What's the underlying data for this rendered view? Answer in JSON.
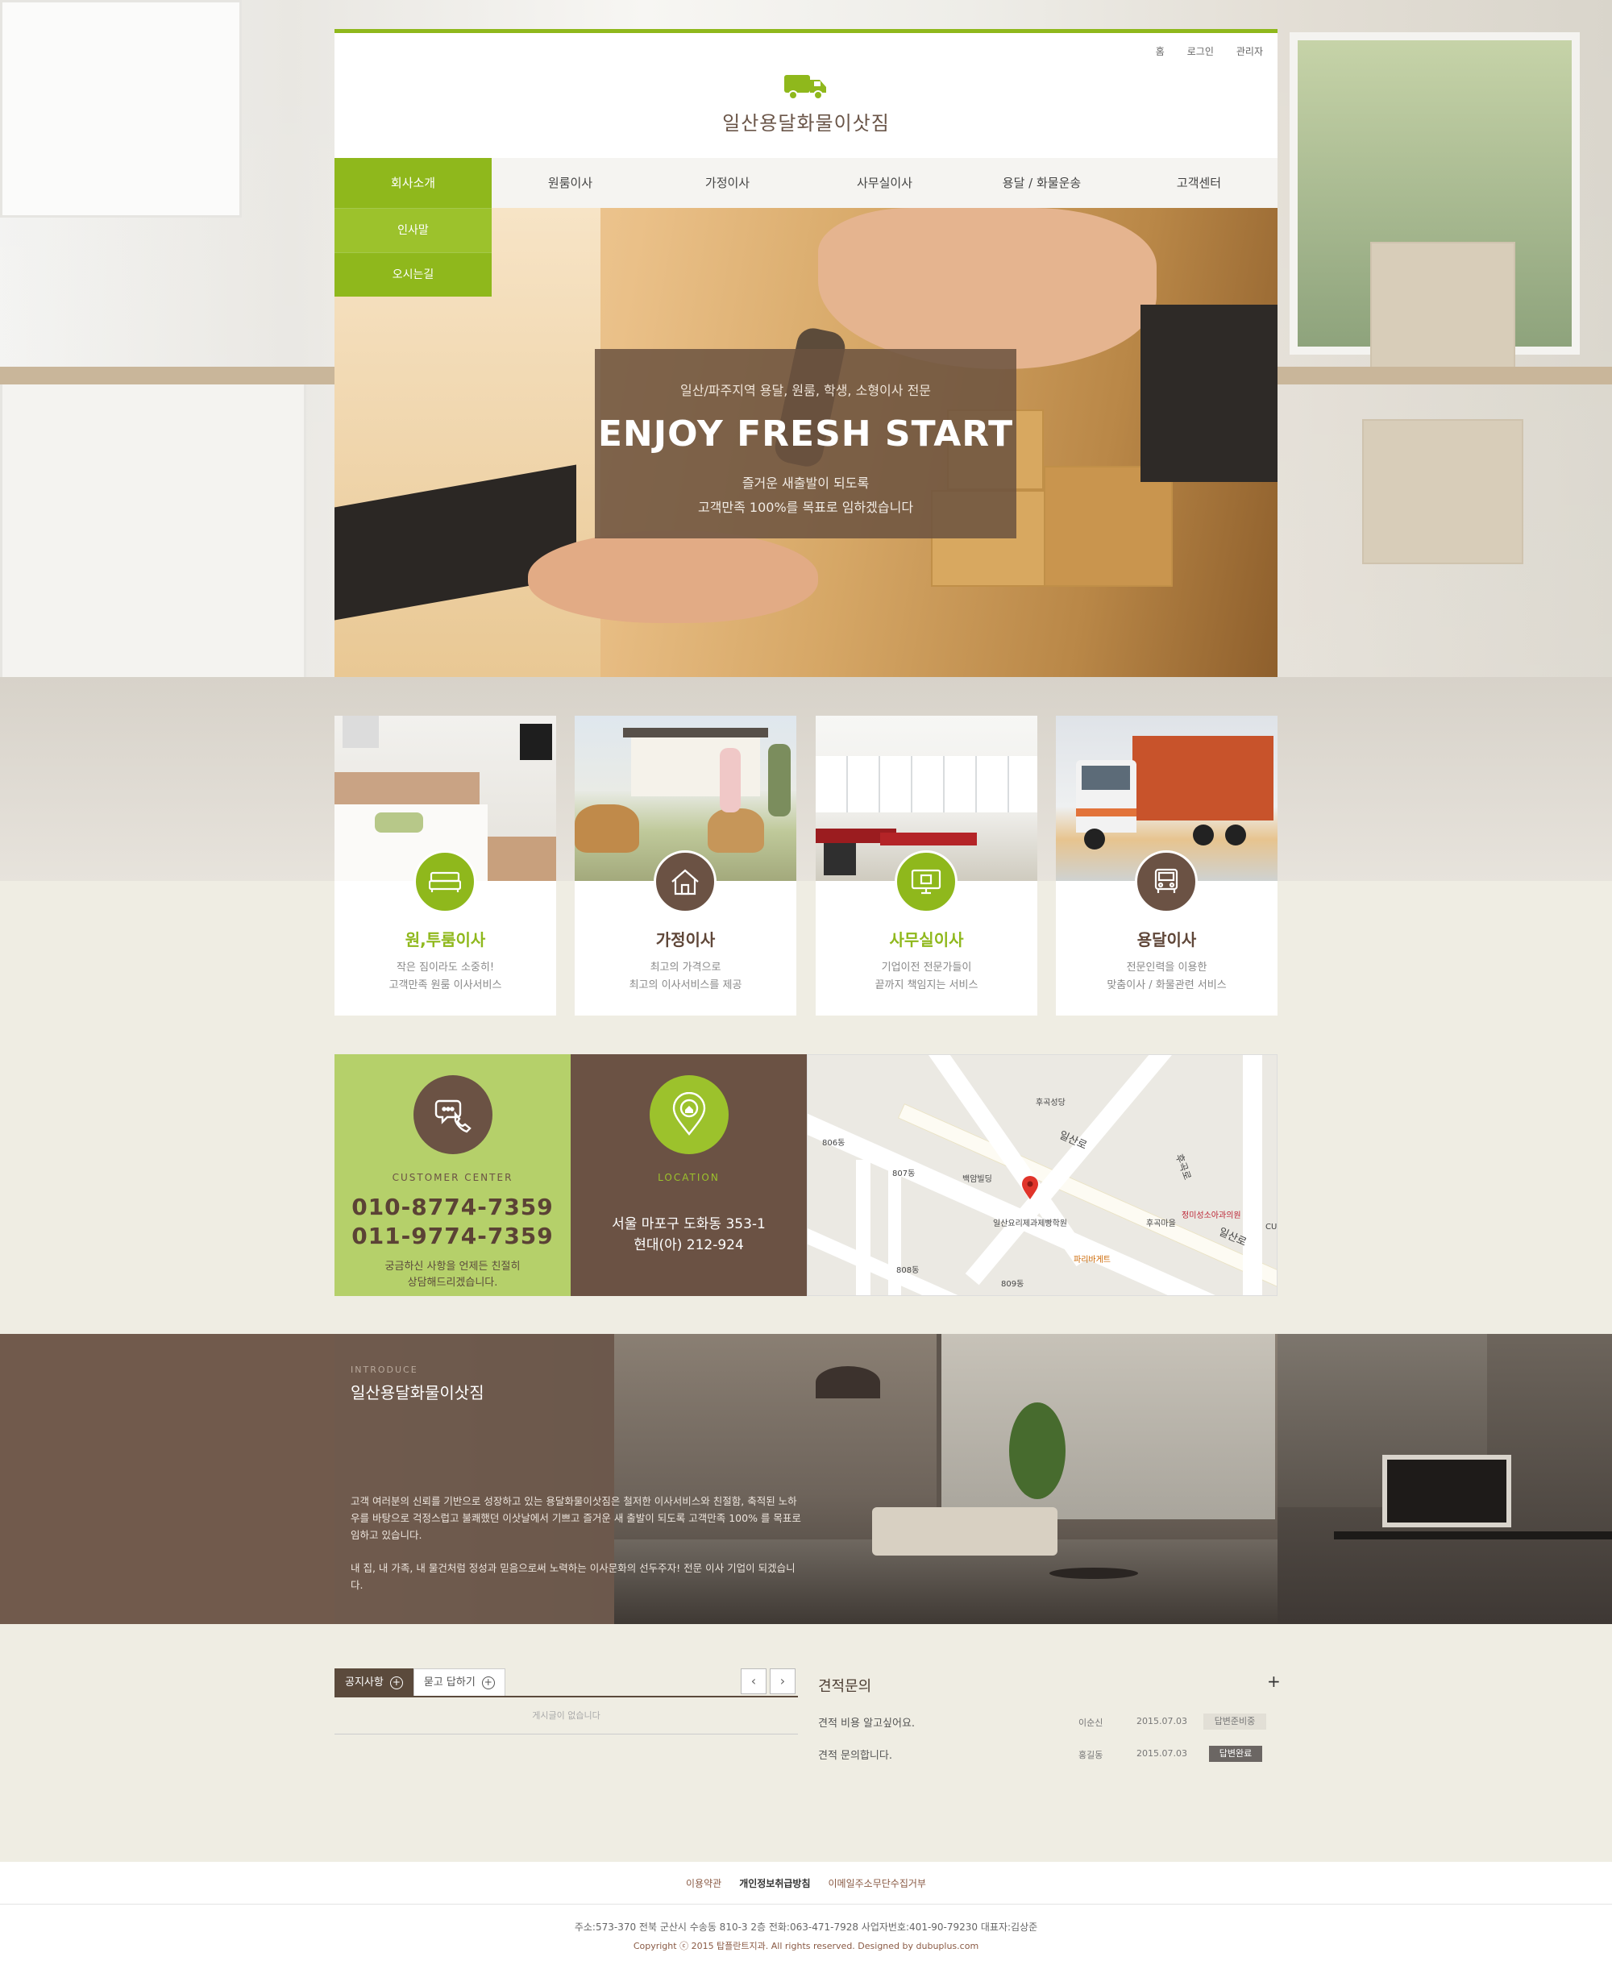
{
  "brand": {
    "name": "일산용달화물이삿짐",
    "accent": "#8fb81c",
    "brown": "#6b5244",
    "truck_icon": "truck-icon"
  },
  "util_links": [
    "홈",
    "로그인",
    "관리자"
  ],
  "nav": [
    "회사소개",
    "원룸이사",
    "가정이사",
    "사무실이사",
    "용달 / 화물운송",
    "고객센터"
  ],
  "submenu": [
    "인사말",
    "오시는길"
  ],
  "hero": {
    "subtitle": "일산/파주지역 용달, 원룸, 학생, 소형이사 전문",
    "title": "ENJOY FRESH START",
    "line1": "즐거운 새출발이 되도록",
    "line2": "고객만족 100%를 목표로 임하겠습니다"
  },
  "services": [
    {
      "title": "원,투룸이사",
      "desc1": "작은 짐이라도 소중히!",
      "desc2": "고객만족 원룸 이사서비스",
      "icon": "bed-icon",
      "color": "green"
    },
    {
      "title": "가정이사",
      "desc1": "최고의 가격으로",
      "desc2": "최고의 이사서비스를 제공",
      "icon": "house-icon",
      "color": "brown"
    },
    {
      "title": "사무실이사",
      "desc1": "기업이전 전문가들이",
      "desc2": "끝까지 책임지는 서비스",
      "icon": "monitor-icon",
      "color": "green"
    },
    {
      "title": "용달이사",
      "desc1": "전문인력을 이용한",
      "desc2": "맞춤이사 / 화물관련 서비스",
      "icon": "truck-front-icon",
      "color": "brown"
    }
  ],
  "customer_center": {
    "label": "CUSTOMER CENTER",
    "phone1": "010-8774-7359",
    "phone2": "011-9774-7359",
    "note1": "궁금하신 사항을 언제든 친절히",
    "note2": "상담해드리겠습니다."
  },
  "location": {
    "label": "LOCATION",
    "addr1": "서울 마포구 도화동 353-1",
    "addr2": "현대(아) 212-924"
  },
  "map": {
    "labels": [
      "후곡성당",
      "806동",
      "807동",
      "백암빌딩",
      "일산로",
      "후곡마을",
      "일산요리제과제빵학원",
      "정미성소아과의원",
      "파리바게트",
      "808동",
      "809동",
      "일산로",
      "CU",
      "후곡로"
    ]
  },
  "introduce": {
    "kicker": "INTRODUCE",
    "title": "일산용달화물이삿짐",
    "p1": "고객 여러분의 신뢰를 기반으로 성장하고 있는 용달화물이삿짐은 철저한 이사서비스와 친절함, 축적된 노하우를 바탕으로 걱정스럽고 불쾌했던 이삿날에서 기쁘고 즐거운 새 출발이 되도록 고객만족 100% 를 목표로 임하고 있습니다.",
    "p2": "내 집, 내 가족, 내 물건처럼 정성과 믿음으로써 노력하는 이사문화의 선두주자! 전문 이사 기업이 되겠습니다."
  },
  "board": {
    "tabs": [
      "공지사항",
      "묻고 답하기"
    ],
    "empty": "게시글이 없습니다",
    "prev": "‹",
    "next": "›"
  },
  "qa": {
    "title": "견적문의",
    "more": "+",
    "rows": [
      {
        "q": "견적 비용 알고싶어요.",
        "who": "이순신",
        "date": "2015.07.03",
        "status": "답변준비중"
      },
      {
        "q": "견적 문의합니다.",
        "who": "홍길동",
        "date": "2015.07.03",
        "status": "답변완료"
      }
    ]
  },
  "footer": {
    "links": [
      "이용약관",
      "개인정보취급방침",
      "이메일주소무단수집거부"
    ],
    "info": "주소:573-370 전북 군산시 수송동 810-3 2층   전화:063-471-7928   사업자번호:401-90-79230  대표자:김상준",
    "copy": "Copyright ⓒ 2015 탑플란트지과. All rights reserved. Designed by dubuplus.com"
  }
}
